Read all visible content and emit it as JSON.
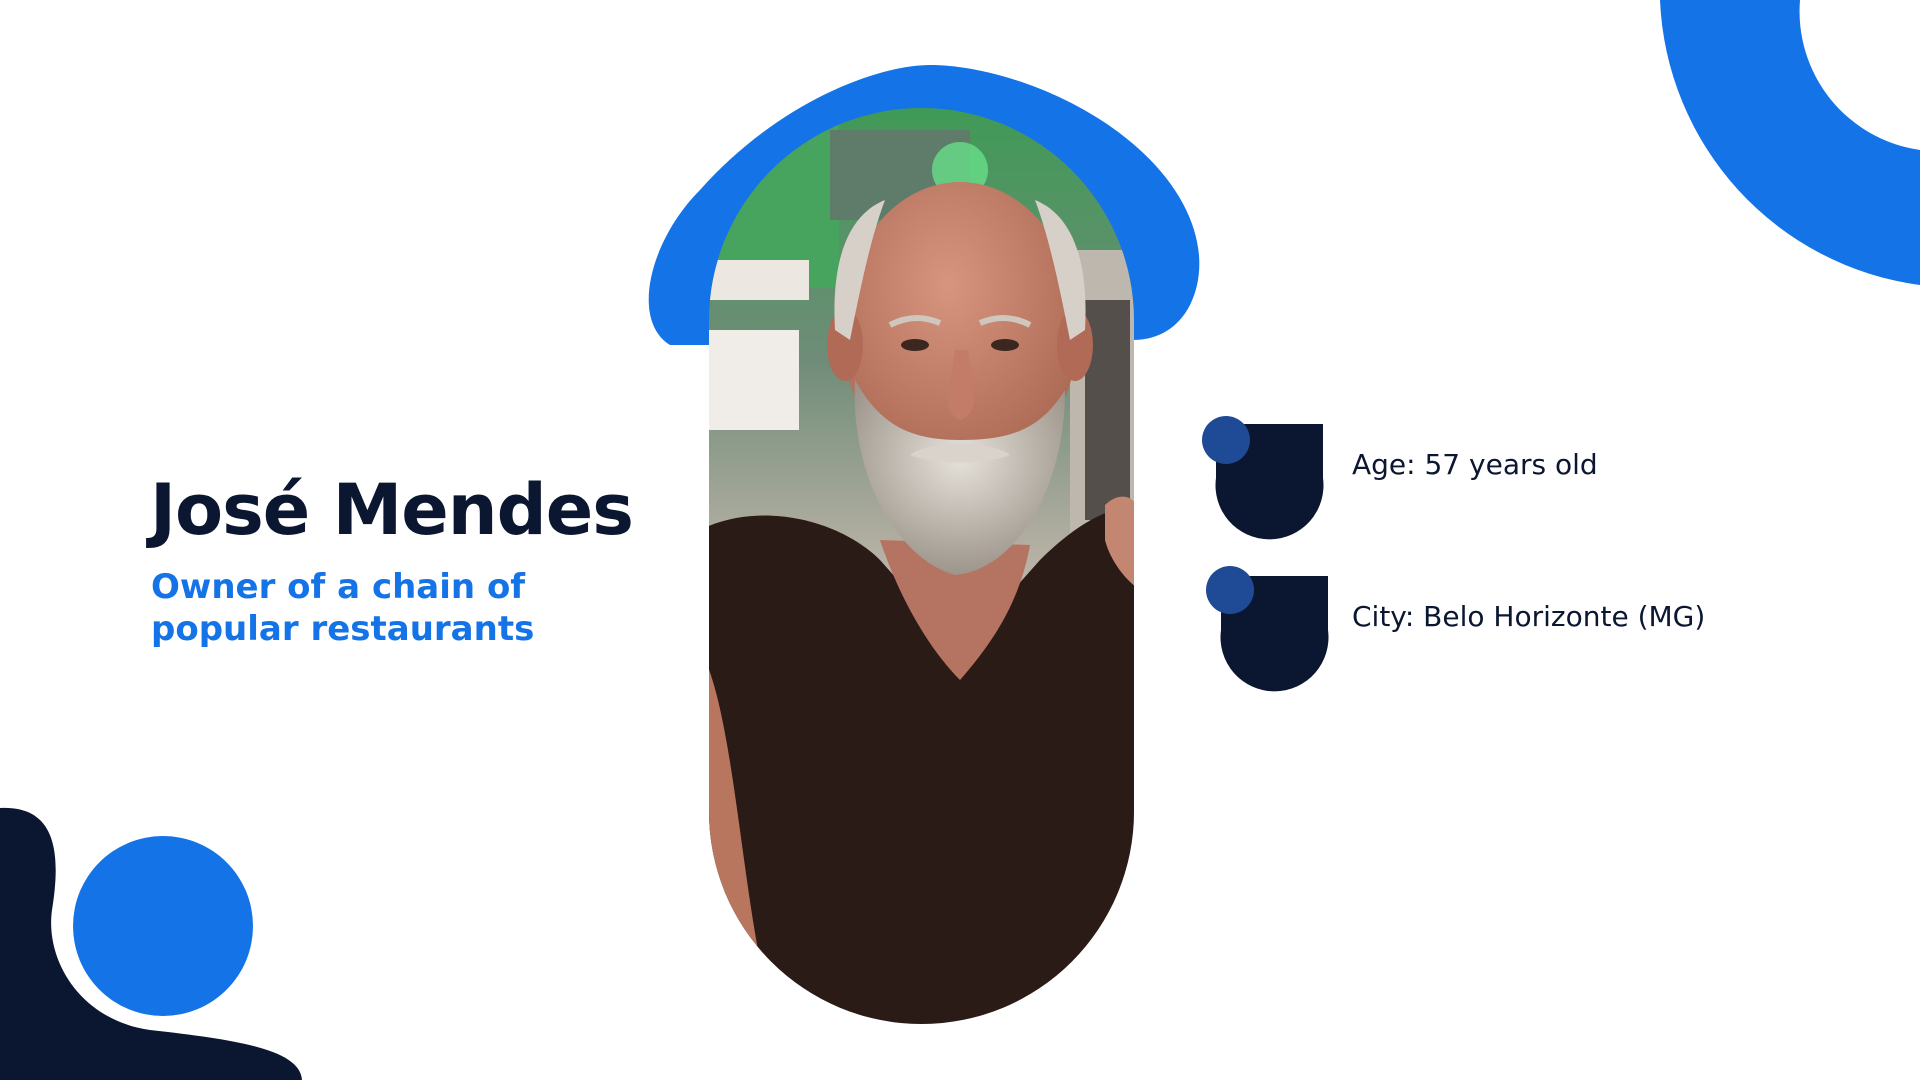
{
  "profile": {
    "name": "José Mendes",
    "role": "Owner of a chain of popular restaurants"
  },
  "details": [
    {
      "icon": "drop-bullet-icon",
      "text": "Age: 57 years old"
    },
    {
      "icon": "drop-bullet-icon",
      "text": "City: Belo Horizonte (MG)"
    }
  ],
  "photo": {
    "subject": "portrait-photo",
    "colors": {
      "shirt": "#2a1b16",
      "skin": "#c48470",
      "beard": "#cfc8c0",
      "background_green": "#3fa35a"
    }
  },
  "colors": {
    "primary_blue": "#1473e6",
    "navy": "#0b1631",
    "bullet_dot": "#1f4b96",
    "background": "#ffffff"
  }
}
